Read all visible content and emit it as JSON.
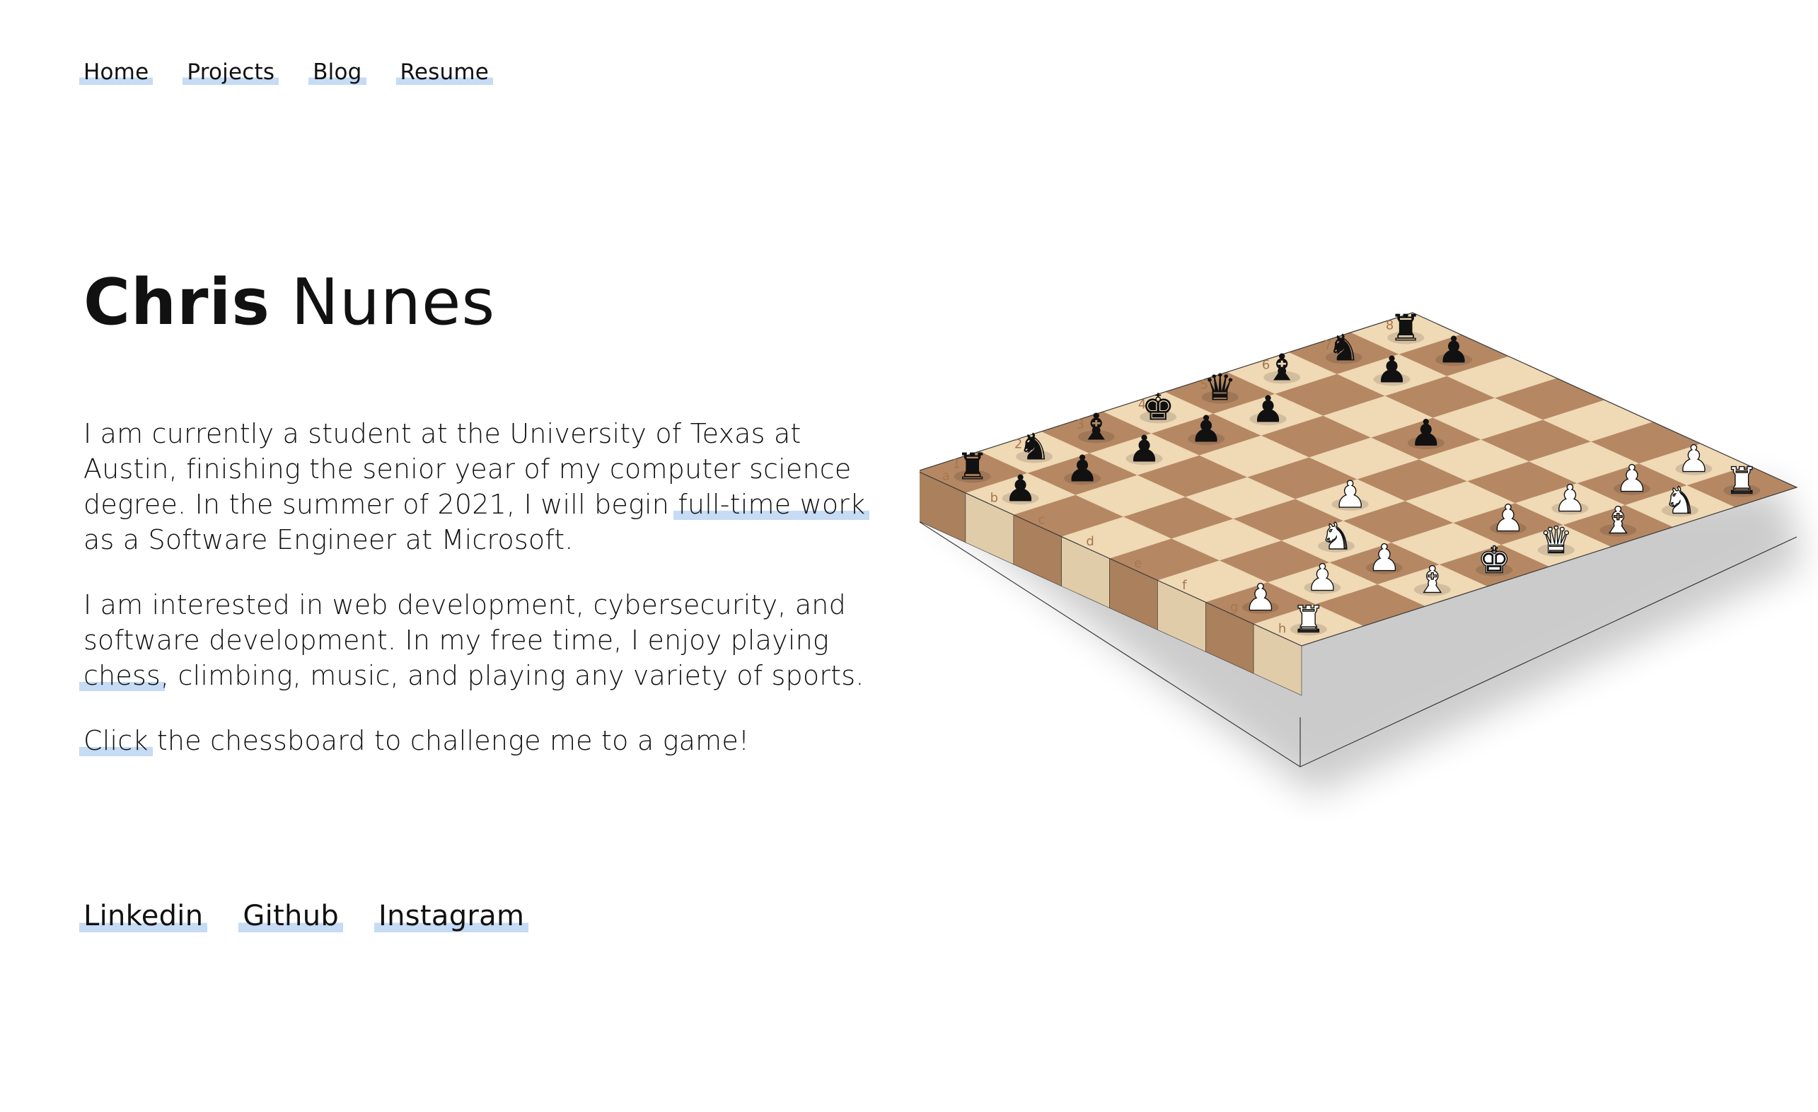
{
  "nav": [
    "Home",
    "Projects",
    "Blog",
    "Resume"
  ],
  "name": {
    "first": "Chris",
    "last": "Nunes"
  },
  "bio": {
    "p1_before": "I am currently a student at the University of Texas at Austin, finishing the senior year of my computer science degree. In the summer of 2021, I will begin ",
    "p1_link": "full-time work",
    "p1_after": " as a Software Engineer at Microsoft.",
    "p2_before": "I am interested in web development, cybersecurity, and software development. In my free time, I enjoy playing ",
    "p2_link": "chess",
    "p2_after": ", climbing, music, and playing any variety of sports.",
    "p3_link": "Click",
    "p3_after": " the chessboard to challenge me to a game!"
  },
  "social": [
    "Linkedin",
    "Github",
    "Instagram"
  ],
  "chessboard": {
    "ranks": [
      "1",
      "2",
      "3",
      "4",
      "5",
      "6",
      "7",
      "8"
    ],
    "files": [
      "a",
      "b",
      "c",
      "d",
      "e",
      "f",
      "g",
      "h"
    ],
    "pieces": [
      {
        "sq": "a8",
        "p": "r",
        "c": "b"
      },
      {
        "sq": "b8",
        "p": "n",
        "c": "b"
      },
      {
        "sq": "c8",
        "p": "b",
        "c": "b"
      },
      {
        "sq": "d8",
        "p": "q",
        "c": "b"
      },
      {
        "sq": "e8",
        "p": "k",
        "c": "b"
      },
      {
        "sq": "f8",
        "p": "b",
        "c": "b"
      },
      {
        "sq": "g8",
        "p": "n",
        "c": "b"
      },
      {
        "sq": "h8",
        "p": "r",
        "c": "b"
      },
      {
        "sq": "a7",
        "p": "p",
        "c": "b"
      },
      {
        "sq": "b7",
        "p": "p",
        "c": "b"
      },
      {
        "sq": "d7",
        "p": "p",
        "c": "b"
      },
      {
        "sq": "e7",
        "p": "p",
        "c": "b"
      },
      {
        "sq": "f7",
        "p": "p",
        "c": "b"
      },
      {
        "sq": "g7",
        "p": "p",
        "c": "b"
      },
      {
        "sq": "h7",
        "p": "p",
        "c": "b"
      },
      {
        "sq": "c5",
        "p": "p",
        "c": "b"
      },
      {
        "sq": "e4",
        "p": "p",
        "c": "w"
      },
      {
        "sq": "f3",
        "p": "n",
        "c": "w"
      },
      {
        "sq": "a2",
        "p": "p",
        "c": "w"
      },
      {
        "sq": "b2",
        "p": "p",
        "c": "w"
      },
      {
        "sq": "c2",
        "p": "p",
        "c": "w"
      },
      {
        "sq": "d2",
        "p": "p",
        "c": "w"
      },
      {
        "sq": "f2",
        "p": "p",
        "c": "w"
      },
      {
        "sq": "g2",
        "p": "p",
        "c": "w"
      },
      {
        "sq": "h2",
        "p": "p",
        "c": "w"
      },
      {
        "sq": "a1",
        "p": "r",
        "c": "w"
      },
      {
        "sq": "b1",
        "p": "n",
        "c": "w"
      },
      {
        "sq": "c1",
        "p": "b",
        "c": "w"
      },
      {
        "sq": "d1",
        "p": "q",
        "c": "w"
      },
      {
        "sq": "e1",
        "p": "k",
        "c": "w"
      },
      {
        "sq": "f1",
        "p": "b",
        "c": "w"
      },
      {
        "sq": "h1",
        "p": "r",
        "c": "w"
      }
    ]
  },
  "colors": {
    "highlight": "#c6dbf4",
    "light_square": "#f0d9b5",
    "dark_square": "#b58863"
  }
}
